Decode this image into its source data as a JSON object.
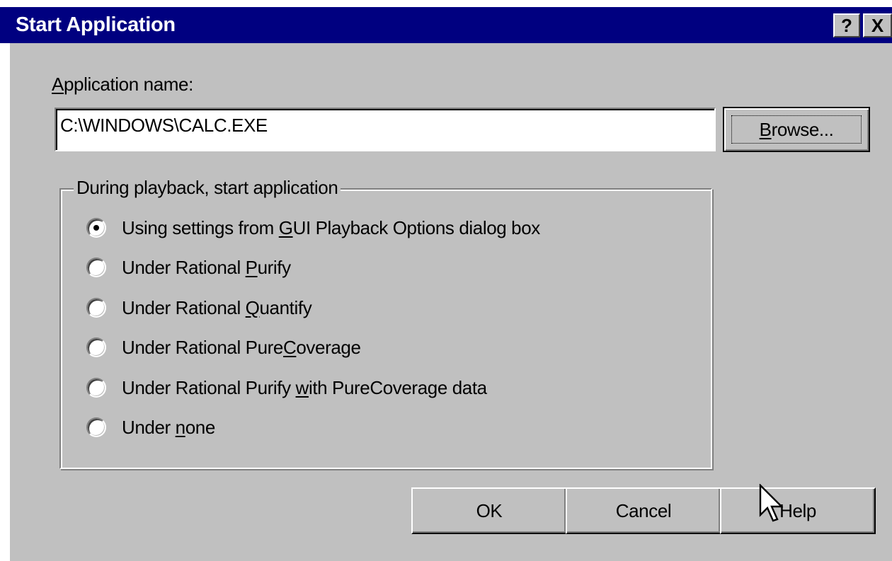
{
  "window": {
    "title": "Start Application",
    "help_glyph": "?",
    "close_glyph": "X"
  },
  "app_name": {
    "label_accel": "A",
    "label_rest": "pplication name:",
    "value": "C:\\WINDOWS\\CALC.EXE"
  },
  "browse_button": {
    "accel": "B",
    "rest": "rowse..."
  },
  "group": {
    "legend": "During playback, start application",
    "options": [
      {
        "pre": "Using settings from ",
        "accel": "G",
        "post": "UI Playback Options dialog box",
        "checked": true
      },
      {
        "pre": "Under Rational ",
        "accel": "P",
        "post": "urify",
        "checked": false
      },
      {
        "pre": "Under Rational ",
        "accel": "Q",
        "post": "uantify",
        "checked": false
      },
      {
        "pre": "Under Rational Pure",
        "accel": "C",
        "post": "overage",
        "checked": false
      },
      {
        "pre": "Under Rational Purify ",
        "accel": "w",
        "post": "ith PureCoverage data",
        "checked": false
      },
      {
        "pre": "Under ",
        "accel": "n",
        "post": "one",
        "checked": false
      }
    ]
  },
  "buttons": {
    "ok": "OK",
    "cancel": "Cancel",
    "help": "Help"
  },
  "colors": {
    "titlebar": "#000080",
    "face": "#c0c0c0"
  }
}
